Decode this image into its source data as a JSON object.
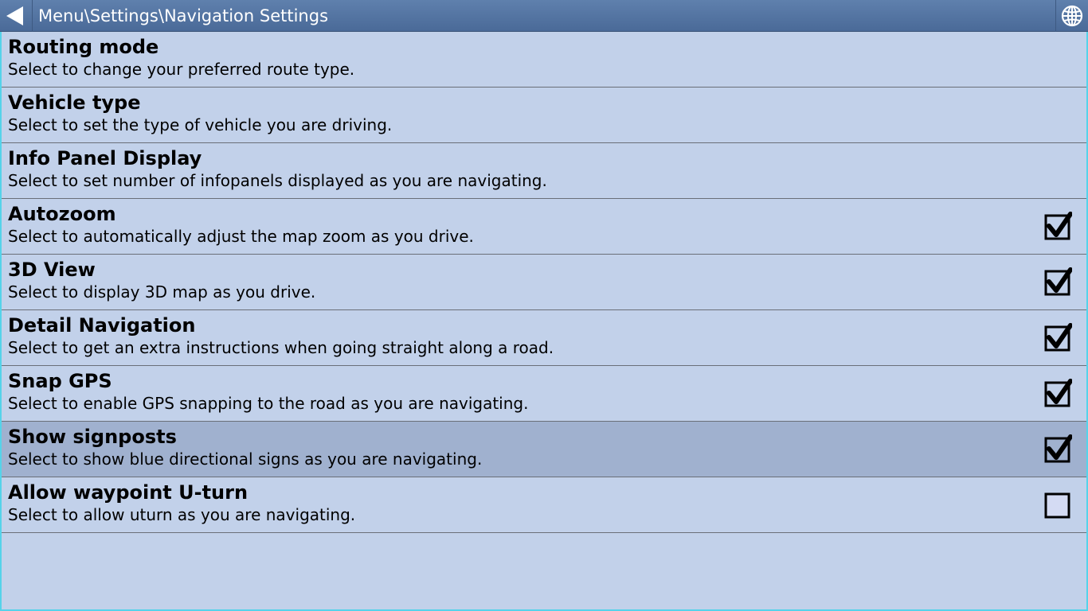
{
  "header": {
    "title": "Menu\\Settings\\Navigation Settings",
    "back_icon": "back-arrow-icon",
    "globe_icon": "globe-icon"
  },
  "settings": [
    {
      "title": "Routing mode",
      "description": "Select to change your preferred route type.",
      "checkbox": null
    },
    {
      "title": "Vehicle type",
      "description": "Select to set the type of vehicle you are driving.",
      "checkbox": null
    },
    {
      "title": "Info Panel Display",
      "description": "Select to set number of infopanels displayed as you are navigating.",
      "checkbox": null
    },
    {
      "title": "Autozoom",
      "description": "Select to automatically adjust the map zoom as you drive.",
      "checkbox": true
    },
    {
      "title": "3D View",
      "description": "Select to display 3D map as you drive.",
      "checkbox": true
    },
    {
      "title": "Detail Navigation",
      "description": "Select to get an extra instructions when going straight along a road.",
      "checkbox": true
    },
    {
      "title": "Snap GPS",
      "description": "Select to enable GPS snapping to the road as you are navigating.",
      "checkbox": true
    },
    {
      "title": "Show signposts",
      "description": "Select to show blue directional signs as you are navigating.",
      "checkbox": true,
      "selected": true
    },
    {
      "title": "Allow waypoint U-turn",
      "description": "Select to allow uturn as you are navigating.",
      "checkbox": false
    }
  ]
}
